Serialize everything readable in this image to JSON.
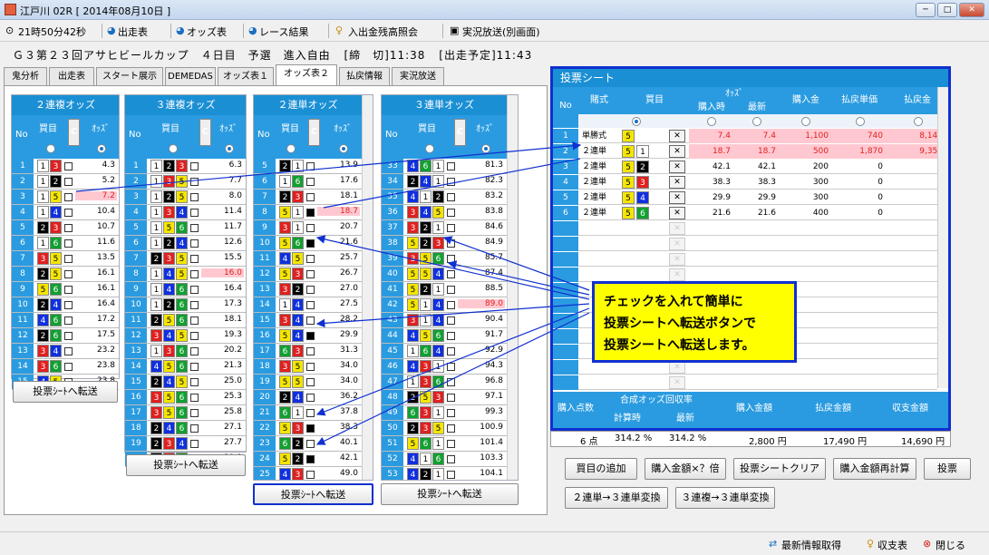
{
  "window": {
    "title": "江戸川 02R [ 2014年08月10日 ]",
    "min": "─",
    "max": "□",
    "close": "✕"
  },
  "toolbar": {
    "time": "21時50分42秒",
    "shussou": "出走表",
    "odds": "オッズ表",
    "result": "レース結果",
    "deposit": "入出金残高照会",
    "live": "実況放送(別画面)"
  },
  "race": {
    "title": "Ｇ３第２３回アサヒビールカップ　４日目　予選　進入自由",
    "deadline": "[締　切]11:38",
    "scheduled": "[出走予定]11:43"
  },
  "tabs": [
    "鬼分析",
    "出走表",
    "スタート展示",
    "DEMEDAS",
    "オッズ表１",
    "オッズ表２",
    "払戻情報",
    "実況放送"
  ],
  "common": {
    "no": "No",
    "kaime": "買目",
    "c": "C",
    "odds": "ｵｯｽﾞ",
    "transfer": "投票ｼｰﾄへ転送"
  },
  "panel1": {
    "title": "２連複オッズ",
    "rows": [
      {
        "no": "1",
        "a": "1",
        "b": "3",
        "o": "4.3",
        "pk": false,
        "ck": false
      },
      {
        "no": "2",
        "a": "1",
        "b": "2",
        "o": "5.2",
        "pk": false,
        "ck": false
      },
      {
        "no": "3",
        "a": "1",
        "b": "5",
        "o": "7.2",
        "pk": true,
        "ck": false
      },
      {
        "no": "4",
        "a": "1",
        "b": "4",
        "o": "10.4",
        "pk": false,
        "ck": false
      },
      {
        "no": "5",
        "a": "2",
        "b": "3",
        "o": "10.7",
        "pk": false,
        "ck": false
      },
      {
        "no": "6",
        "a": "1",
        "b": "6",
        "o": "11.6",
        "pk": false,
        "ck": false
      },
      {
        "no": "7",
        "a": "3",
        "b": "5",
        "o": "13.5",
        "pk": false,
        "ck": false
      },
      {
        "no": "8",
        "a": "2",
        "b": "5",
        "o": "16.1",
        "pk": false,
        "ck": false
      },
      {
        "no": "9",
        "a": "5",
        "b": "6",
        "o": "16.1",
        "pk": false,
        "ck": false
      },
      {
        "no": "10",
        "a": "2",
        "b": "4",
        "o": "16.4",
        "pk": false,
        "ck": false
      },
      {
        "no": "11",
        "a": "4",
        "b": "6",
        "o": "17.2",
        "pk": false,
        "ck": false
      },
      {
        "no": "12",
        "a": "2",
        "b": "6",
        "o": "17.5",
        "pk": false,
        "ck": false
      },
      {
        "no": "13",
        "a": "3",
        "b": "4",
        "o": "23.2",
        "pk": false,
        "ck": false
      },
      {
        "no": "14",
        "a": "3",
        "b": "6",
        "o": "23.8",
        "pk": false,
        "ck": false
      },
      {
        "no": "15",
        "a": "4",
        "b": "5",
        "o": "23.8",
        "pk": false,
        "ck": false
      }
    ]
  },
  "panel2": {
    "title": "３連複オッズ",
    "rows": [
      {
        "no": "1",
        "a": "1",
        "b": "2",
        "c": "3",
        "o": "6.3",
        "pk": false
      },
      {
        "no": "2",
        "a": "1",
        "b": "3",
        "c": "5",
        "o": "7.7",
        "pk": false
      },
      {
        "no": "3",
        "a": "1",
        "b": "2",
        "c": "5",
        "o": "8.0",
        "pk": false
      },
      {
        "no": "4",
        "a": "1",
        "b": "3",
        "c": "4",
        "o": "11.4",
        "pk": false
      },
      {
        "no": "5",
        "a": "1",
        "b": "5",
        "c": "6",
        "o": "11.7",
        "pk": false
      },
      {
        "no": "6",
        "a": "1",
        "b": "2",
        "c": "4",
        "o": "12.6",
        "pk": false
      },
      {
        "no": "7",
        "a": "2",
        "b": "3",
        "c": "5",
        "o": "15.5",
        "pk": false
      },
      {
        "no": "8",
        "a": "1",
        "b": "4",
        "c": "5",
        "o": "16.0",
        "pk": true
      },
      {
        "no": "9",
        "a": "1",
        "b": "4",
        "c": "6",
        "o": "16.4",
        "pk": false
      },
      {
        "no": "10",
        "a": "1",
        "b": "2",
        "c": "6",
        "o": "17.3",
        "pk": false
      },
      {
        "no": "11",
        "a": "2",
        "b": "5",
        "c": "6",
        "o": "18.1",
        "pk": false
      },
      {
        "no": "12",
        "a": "3",
        "b": "4",
        "c": "5",
        "o": "19.3",
        "pk": false
      },
      {
        "no": "13",
        "a": "1",
        "b": "3",
        "c": "6",
        "o": "20.2",
        "pk": false
      },
      {
        "no": "14",
        "a": "4",
        "b": "5",
        "c": "6",
        "o": "21.3",
        "pk": false
      },
      {
        "no": "15",
        "a": "2",
        "b": "4",
        "c": "5",
        "o": "25.0",
        "pk": false
      },
      {
        "no": "16",
        "a": "3",
        "b": "5",
        "c": "6",
        "o": "25.3",
        "pk": false
      },
      {
        "no": "17",
        "a": "3",
        "b": "5",
        "c": "6",
        "o": "25.8",
        "pk": false
      },
      {
        "no": "18",
        "a": "2",
        "b": "4",
        "c": "6",
        "o": "27.1",
        "pk": false
      },
      {
        "no": "19",
        "a": "2",
        "b": "3",
        "c": "4",
        "o": "27.7",
        "pk": false
      },
      {
        "no": "20",
        "a": "2",
        "b": "3",
        "c": "6",
        "o": "30.9",
        "pk": false
      }
    ]
  },
  "panel3": {
    "title": "２連単オッズ",
    "rows": [
      {
        "no": "5",
        "a": "2",
        "b": "1",
        "o": "13.9",
        "pk": false,
        "ck": false
      },
      {
        "no": "6",
        "a": "1",
        "b": "6",
        "o": "17.6",
        "pk": false,
        "ck": false
      },
      {
        "no": "7",
        "a": "2",
        "b": "3",
        "o": "18.1",
        "pk": false,
        "ck": false
      },
      {
        "no": "8",
        "a": "5",
        "b": "1",
        "o": "18.7",
        "pk": true,
        "ck": true
      },
      {
        "no": "9",
        "a": "3",
        "b": "1",
        "o": "20.7",
        "pk": false,
        "ck": false
      },
      {
        "no": "10",
        "a": "5",
        "b": "6",
        "o": "21.6",
        "pk": false,
        "ck": true
      },
      {
        "no": "11",
        "a": "4",
        "b": "5",
        "o": "25.7",
        "pk": false,
        "ck": false
      },
      {
        "no": "12",
        "a": "5",
        "b": "3",
        "o": "26.7",
        "pk": false,
        "ck": false
      },
      {
        "no": "13",
        "a": "3",
        "b": "2",
        "o": "27.0",
        "pk": false,
        "ck": false
      },
      {
        "no": "14",
        "a": "1",
        "b": "4",
        "o": "27.5",
        "pk": false,
        "ck": false
      },
      {
        "no": "15",
        "a": "3",
        "b": "4",
        "o": "28.2",
        "pk": false,
        "ck": false
      },
      {
        "no": "16",
        "a": "5",
        "b": "4",
        "o": "29.9",
        "pk": false,
        "ck": true
      },
      {
        "no": "17",
        "a": "6",
        "b": "3",
        "o": "31.3",
        "pk": false,
        "ck": false
      },
      {
        "no": "18",
        "a": "3",
        "b": "5",
        "o": "34.0",
        "pk": false,
        "ck": false
      },
      {
        "no": "19",
        "a": "5",
        "b": "5",
        "o": "34.0",
        "pk": false,
        "ck": false
      },
      {
        "no": "20",
        "a": "2",
        "b": "4",
        "o": "36.2",
        "pk": false,
        "ck": false
      },
      {
        "no": "21",
        "a": "6",
        "b": "1",
        "o": "37.8",
        "pk": false,
        "ck": false
      },
      {
        "no": "22",
        "a": "5",
        "b": "3",
        "o": "38.3",
        "pk": false,
        "ck": true
      },
      {
        "no": "23",
        "a": "6",
        "b": "2",
        "o": "40.1",
        "pk": false,
        "ck": false
      },
      {
        "no": "24",
        "a": "5",
        "b": "2",
        "o": "42.1",
        "pk": false,
        "ck": true
      },
      {
        "no": "25",
        "a": "4",
        "b": "3",
        "o": "49.0",
        "pk": false,
        "ck": false
      },
      {
        "no": "26",
        "a": "6",
        "b": "3",
        "o": "49.0",
        "pk": false,
        "ck": false
      }
    ]
  },
  "panel4": {
    "title": "３連単オッズ",
    "rows": [
      {
        "no": "33",
        "a": "4",
        "b": "6",
        "c": "1",
        "o": "81.3",
        "pk": false
      },
      {
        "no": "34",
        "a": "2",
        "b": "4",
        "c": "1",
        "o": "82.3",
        "pk": false
      },
      {
        "no": "35",
        "a": "4",
        "b": "1",
        "c": "2",
        "o": "83.2",
        "pk": false
      },
      {
        "no": "36",
        "a": "3",
        "b": "4",
        "c": "5",
        "o": "83.8",
        "pk": false
      },
      {
        "no": "37",
        "a": "3",
        "b": "2",
        "c": "1",
        "o": "84.6",
        "pk": false
      },
      {
        "no": "38",
        "a": "5",
        "b": "2",
        "c": "3",
        "o": "84.9",
        "pk": false
      },
      {
        "no": "39",
        "a": "3",
        "b": "5",
        "c": "6",
        "o": "85.7",
        "pk": false
      },
      {
        "no": "40",
        "a": "5",
        "b": "5",
        "c": "4",
        "o": "87.4",
        "pk": false
      },
      {
        "no": "41",
        "a": "5",
        "b": "2",
        "c": "1",
        "o": "88.5",
        "pk": false
      },
      {
        "no": "42",
        "a": "5",
        "b": "1",
        "c": "4",
        "o": "89.0",
        "pk": true
      },
      {
        "no": "43",
        "a": "3",
        "b": "1",
        "c": "4",
        "o": "90.4",
        "pk": false
      },
      {
        "no": "44",
        "a": "4",
        "b": "5",
        "c": "6",
        "o": "91.7",
        "pk": false
      },
      {
        "no": "45",
        "a": "1",
        "b": "6",
        "c": "4",
        "o": "92.9",
        "pk": false
      },
      {
        "no": "46",
        "a": "4",
        "b": "3",
        "c": "1",
        "o": "94.3",
        "pk": false
      },
      {
        "no": "47",
        "a": "1",
        "b": "3",
        "c": "6",
        "o": "96.8",
        "pk": false
      },
      {
        "no": "48",
        "a": "2",
        "b": "5",
        "c": "3",
        "o": "97.1",
        "pk": false
      },
      {
        "no": "49",
        "a": "6",
        "b": "3",
        "c": "1",
        "o": "99.3",
        "pk": false
      },
      {
        "no": "50",
        "a": "2",
        "b": "3",
        "c": "5",
        "o": "100.9",
        "pk": false
      },
      {
        "no": "51",
        "a": "5",
        "b": "6",
        "c": "1",
        "o": "101.4",
        "pk": false
      },
      {
        "no": "52",
        "a": "4",
        "b": "1",
        "c": "6",
        "o": "103.3",
        "pk": false
      },
      {
        "no": "53",
        "a": "4",
        "b": "2",
        "c": "1",
        "o": "104.1",
        "pk": false
      },
      {
        "no": "54",
        "a": "4",
        "b": "3",
        "c": "1",
        "o": "105.9",
        "pk": false
      }
    ]
  },
  "ticket": {
    "title": "投票シート",
    "h_no": "No",
    "h_type": "賭式",
    "h_kaime": "買目",
    "h_odds": "ｵｯｽﾞ",
    "h_at": "購入時",
    "h_latest": "最新",
    "h_amount": "購入金",
    "h_unit": "払戻単価",
    "h_refund": "払戻金",
    "x": "✕",
    "rows": [
      {
        "no": "1",
        "type": "単勝式",
        "k1": "5",
        "k2": "",
        "at": "7.4",
        "latest": "7.4",
        "amt": "1,100",
        "unit": "740",
        "refund": "8,140",
        "pk": true
      },
      {
        "no": "2",
        "type": "２連単",
        "k1": "5",
        "k2": "1",
        "at": "18.7",
        "latest": "18.7",
        "amt": "500",
        "unit": "1,870",
        "refund": "9,350",
        "pk": true
      },
      {
        "no": "3",
        "type": "２連単",
        "k1": "5",
        "k2": "2",
        "at": "42.1",
        "latest": "42.1",
        "amt": "200",
        "unit": "0",
        "refund": "0",
        "pk": false
      },
      {
        "no": "4",
        "type": "２連単",
        "k1": "5",
        "k2": "3",
        "at": "38.3",
        "latest": "38.3",
        "amt": "300",
        "unit": "0",
        "refund": "0",
        "pk": false
      },
      {
        "no": "5",
        "type": "２連単",
        "k1": "5",
        "k2": "4",
        "at": "29.9",
        "latest": "29.9",
        "amt": "300",
        "unit": "0",
        "refund": "0",
        "pk": false
      },
      {
        "no": "6",
        "type": "２連単",
        "k1": "5",
        "k2": "6",
        "at": "21.6",
        "latest": "21.6",
        "amt": "400",
        "unit": "0",
        "refund": "0",
        "pk": false
      }
    ],
    "f_count": "購入点数",
    "f_combo": "合成オッズ回収率",
    "f_at": "計算時",
    "f_latest": "最新",
    "f_buy": "購入金額",
    "f_refund": "払戻金額",
    "f_balance": "収支金額"
  },
  "summary": {
    "count": "6 点",
    "at": "314.2 %",
    "latest": "314.2 %",
    "buy": "2,800 円",
    "refund": "17,490 円",
    "balance": "14,690 円"
  },
  "buttons": {
    "add": "買目の追加",
    "multiply": "購入金額×？倍",
    "clear": "投票シートクリア",
    "recalc": "購入金額再計算",
    "vote": "投票",
    "conv1": "２連単→３連単変換",
    "conv2": "３連複→３連単変換"
  },
  "callout": [
    "チェックを入れて簡単に",
    "投票シートへ転送ボタンで",
    "投票シートへ転送します。"
  ],
  "footer": {
    "refresh": "最新情報取得",
    "balance": "収支表",
    "close": "閉じる"
  },
  "colors": {
    "1": "#ffffff",
    "2": "#000000",
    "3": "#e02020",
    "4": "#1030e0",
    "5": "#f5e600",
    "6": "#10a030",
    "header": "#1a8fd4",
    "subheader": "#2a9be0",
    "highlight": "#1030d0"
  }
}
